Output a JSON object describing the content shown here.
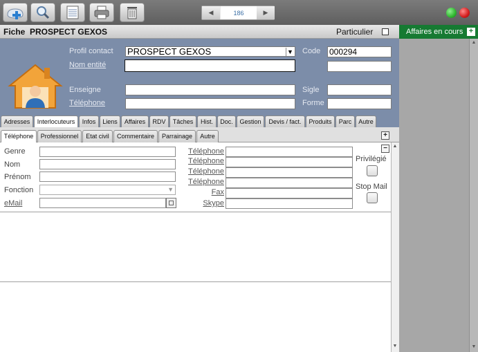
{
  "toolbar": {
    "buttons": [
      {
        "icon": "new-record-icon"
      },
      {
        "icon": "search-icon"
      },
      {
        "icon": "list-icon"
      },
      {
        "icon": "printer-icon"
      },
      {
        "icon": "trash-icon"
      }
    ],
    "record_number": "186",
    "status_colors": {
      "green": "#2fb52f",
      "red": "#d21c1c"
    }
  },
  "titlebar": {
    "title": "Fiche  PROSPECT GEXOS",
    "particulier_label": "Particulier"
  },
  "side_panel": {
    "title": "Affaires en cours",
    "add_symbol": "+",
    "header_color": "#167a32"
  },
  "header": {
    "profil_label": "Profil contact",
    "profil_value": "PROSPECT GEXOS",
    "nom_entite_label": "Nom entité",
    "nom_entite_value": "",
    "enseigne_label": "Enseigne",
    "enseigne_value": "",
    "telephone_label": "Téléphone",
    "telephone_value": "",
    "code_label": "Code",
    "code_value": "000294",
    "code2_value": "",
    "sigle_label": "Sigle",
    "sigle_value": "",
    "forme_label": "Forme",
    "forme_value": "",
    "bg_color": "#7c8da9"
  },
  "tabs": [
    "Adresses",
    "Interlocuteurs",
    "Infos",
    "Liens",
    "Affaires",
    "RDV",
    "Tâches",
    "Hist.",
    "Doc.",
    "Gestion",
    "Devis / fact.",
    "Produits",
    "Parc",
    "Autre"
  ],
  "active_tab": "Interlocuteurs",
  "subtabs": [
    "Téléphone",
    "Professionnel",
    "Etat civil",
    "Commentaire",
    "Parrainage",
    "Autre"
  ],
  "active_subtab": "Téléphone",
  "form": {
    "left_labels": {
      "genre": "Genre",
      "nom": "Nom",
      "prenom": "Prénom",
      "fonction": "Fonction",
      "email": "eMail"
    },
    "phone_labels": {
      "tel1": "Téléphone",
      "tel2": "Téléphone",
      "tel3": "Téléphone",
      "tel4": "Téléphone",
      "fax": "Fax",
      "skype": "Skype"
    },
    "privilegie_label": "Privilégié",
    "stop_mail_label": "Stop Mail",
    "minus_symbol": "−",
    "plus_symbol": "+"
  }
}
